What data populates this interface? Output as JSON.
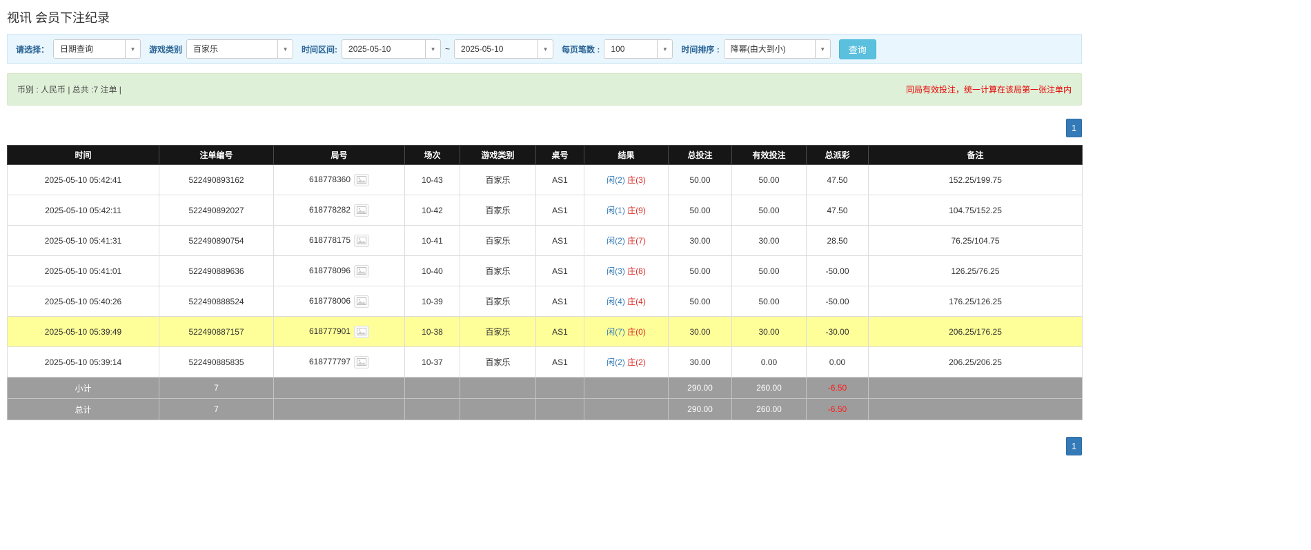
{
  "page": {
    "title": "视讯 会员下注纪录"
  },
  "colors": {
    "accent_blue": "#337ab7",
    "search_button_cyan": "#5bc0de",
    "header_black": "#161616",
    "highlight_yellow": "#ffff99",
    "negative_red": "#e60000",
    "banker_red": "#d9302c",
    "summary_green_bg": "#dff0d8",
    "filter_bar_blue_bg": "#e9f6fd",
    "footer_gray": "#9d9d9d"
  },
  "icons": {
    "dropdown_caret": "▼",
    "round_image_icon": "image-placeholder"
  },
  "filters": {
    "select_label": "请选择：",
    "select_value": "日期查询",
    "game_type_label": "游戏类别",
    "game_type_value": "百家乐",
    "time_range_label": "时间区间:",
    "date_from": "2025-05-10",
    "tilde": "~",
    "date_to": "2025-05-10",
    "page_size_label": "每页笔数 :",
    "page_size_value": "100",
    "sort_label": "时间排序 :",
    "sort_value": "降幂(由大到小)",
    "search_button": "查询"
  },
  "summary": {
    "left": "币别 : 人民币 | 总共 :7 注单 |",
    "right": "同局有效投注，统一计算在该局第一张注单内"
  },
  "pagination": {
    "page": "1"
  },
  "table": {
    "headers": [
      "时间",
      "注单编号",
      "局号",
      "场次",
      "游戏类别",
      "桌号",
      "结果",
      "总投注",
      "有效投注",
      "总派彩",
      "备注"
    ],
    "rows": [
      {
        "time": "2025-05-10 05:42:41",
        "bet_id": "522490893162",
        "round": "618778360",
        "session": "10-43",
        "game": "百家乐",
        "table": "AS1",
        "player": "闲(2)",
        "banker": "庄(3)",
        "total_bet": "50.00",
        "valid_bet": "50.00",
        "payout": "47.50",
        "payout_negative": false,
        "note": "152.25/199.75",
        "highlight": false
      },
      {
        "time": "2025-05-10 05:42:11",
        "bet_id": "522490892027",
        "round": "618778282",
        "session": "10-42",
        "game": "百家乐",
        "table": "AS1",
        "player": "闲(1)",
        "banker": "庄(9)",
        "total_bet": "50.00",
        "valid_bet": "50.00",
        "payout": "47.50",
        "payout_negative": false,
        "note": "104.75/152.25",
        "highlight": false
      },
      {
        "time": "2025-05-10 05:41:31",
        "bet_id": "522490890754",
        "round": "618778175",
        "session": "10-41",
        "game": "百家乐",
        "table": "AS1",
        "player": "闲(2)",
        "banker": "庄(7)",
        "total_bet": "30.00",
        "valid_bet": "30.00",
        "payout": "28.50",
        "payout_negative": false,
        "note": "76.25/104.75",
        "highlight": false
      },
      {
        "time": "2025-05-10 05:41:01",
        "bet_id": "522490889636",
        "round": "618778096",
        "session": "10-40",
        "game": "百家乐",
        "table": "AS1",
        "player": "闲(3)",
        "banker": "庄(8)",
        "total_bet": "50.00",
        "valid_bet": "50.00",
        "payout": "-50.00",
        "payout_negative": true,
        "note": "126.25/76.25",
        "highlight": false
      },
      {
        "time": "2025-05-10 05:40:26",
        "bet_id": "522490888524",
        "round": "618778006",
        "session": "10-39",
        "game": "百家乐",
        "table": "AS1",
        "player": "闲(4)",
        "banker": "庄(4)",
        "total_bet": "50.00",
        "valid_bet": "50.00",
        "payout": "-50.00",
        "payout_negative": true,
        "note": "176.25/126.25",
        "highlight": false
      },
      {
        "time": "2025-05-10 05:39:49",
        "bet_id": "522490887157",
        "round": "618777901",
        "session": "10-38",
        "game": "百家乐",
        "table": "AS1",
        "player": "闲(7)",
        "banker": "庄(0)",
        "total_bet": "30.00",
        "valid_bet": "30.00",
        "payout": "-30.00",
        "payout_negative": true,
        "note": "206.25/176.25",
        "highlight": true
      },
      {
        "time": "2025-05-10 05:39:14",
        "bet_id": "522490885835",
        "round": "618777797",
        "session": "10-37",
        "game": "百家乐",
        "table": "AS1",
        "player": "闲(2)",
        "banker": "庄(2)",
        "total_bet": "30.00",
        "valid_bet": "0.00",
        "payout": "0.00",
        "payout_negative": false,
        "note": "206.25/206.25",
        "highlight": false
      }
    ],
    "subtotal": {
      "label": "小计",
      "count": "7",
      "total_bet": "290.00",
      "valid_bet": "260.00",
      "payout": "-6.50"
    },
    "total": {
      "label": "总计",
      "count": "7",
      "total_bet": "290.00",
      "valid_bet": "260.00",
      "payout": "-6.50"
    }
  }
}
